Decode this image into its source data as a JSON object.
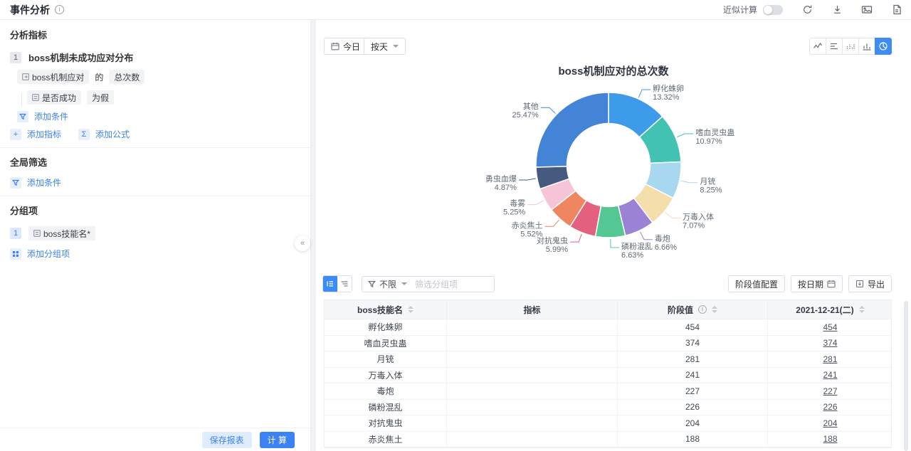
{
  "header": {
    "title": "事件分析",
    "approx_calc_label": "近似计算",
    "approx_toggle_on": false
  },
  "sidebar": {
    "metrics_section_title": "分析指标",
    "metric_index": "1",
    "metric_name": "boss机制未成功应对分布",
    "event_name": "boss机制应对",
    "of_label": "的",
    "aggregation": "总次数",
    "condition_field": "是否成功",
    "condition_value": "为假",
    "add_condition_label": "添加条件",
    "add_metric_label": "添加指标",
    "add_formula_label": "添加公式",
    "global_filter_title": "全局筛选",
    "global_add_condition_label": "添加条件",
    "group_section_title": "分组项",
    "group_index": "1",
    "group_field": "boss技能名*",
    "add_group_label": "添加分组项",
    "save_report_label": "保存报表",
    "calculate_label": "计 算",
    "collapse_glyph": "«"
  },
  "toolbar": {
    "date_range_label": "今日",
    "granularity_label": "按天"
  },
  "chart_data": {
    "type": "pie",
    "donut": true,
    "title": "boss机制应对的总次数",
    "legend_position": "none",
    "unit": "%",
    "series": [
      {
        "name": "孵化蛛卵",
        "percent": 13.32,
        "color": "#3d9be9"
      },
      {
        "name": "嗜血灵虫蛊",
        "percent": 10.97,
        "color": "#41c2b3"
      },
      {
        "name": "月铳",
        "percent": 8.25,
        "color": "#a8d8ef"
      },
      {
        "name": "万毒入体",
        "percent": 7.07,
        "color": "#f4dfac"
      },
      {
        "name": "毒炮",
        "percent": 6.66,
        "color": "#9c82d4"
      },
      {
        "name": "磷粉混乱",
        "percent": 6.63,
        "color": "#55c795"
      },
      {
        "name": "对抗鬼虫",
        "percent": 5.99,
        "color": "#e4607f"
      },
      {
        "name": "赤炎焦土",
        "percent": 5.52,
        "color": "#ef8561"
      },
      {
        "name": "毒雾",
        "percent": 5.25,
        "color": "#f6c3d7"
      },
      {
        "name": "勇虫血爆",
        "percent": 4.87,
        "color": "#465a80"
      },
      {
        "name": "其他",
        "percent": 25.47,
        "color": "#4384d6"
      }
    ]
  },
  "table_controls": {
    "filter_scope": "不限",
    "filter_placeholder": "筛选分组项",
    "stage_config_label": "阶段值配置",
    "by_date_label": "按日期",
    "export_label": "导出"
  },
  "table": {
    "columns": [
      "boss技能名",
      "指标",
      "阶段值",
      "2021-12-21(二)"
    ],
    "rows": [
      {
        "skill": "孵化蛛卵",
        "metric": "",
        "stage": "454",
        "day": "454"
      },
      {
        "skill": "嗜血灵虫蛊",
        "metric": "",
        "stage": "374",
        "day": "374"
      },
      {
        "skill": "月铳",
        "metric": "",
        "stage": "281",
        "day": "281"
      },
      {
        "skill": "万毒入体",
        "metric": "",
        "stage": "241",
        "day": "241"
      },
      {
        "skill": "毒炮",
        "metric": "",
        "stage": "227",
        "day": "227"
      },
      {
        "skill": "磷粉混乱",
        "metric": "",
        "stage": "226",
        "day": "226"
      },
      {
        "skill": "对抗鬼虫",
        "metric": "",
        "stage": "204",
        "day": "204"
      },
      {
        "skill": "赤炎焦土",
        "metric": "",
        "stage": "188",
        "day": "188"
      }
    ]
  }
}
